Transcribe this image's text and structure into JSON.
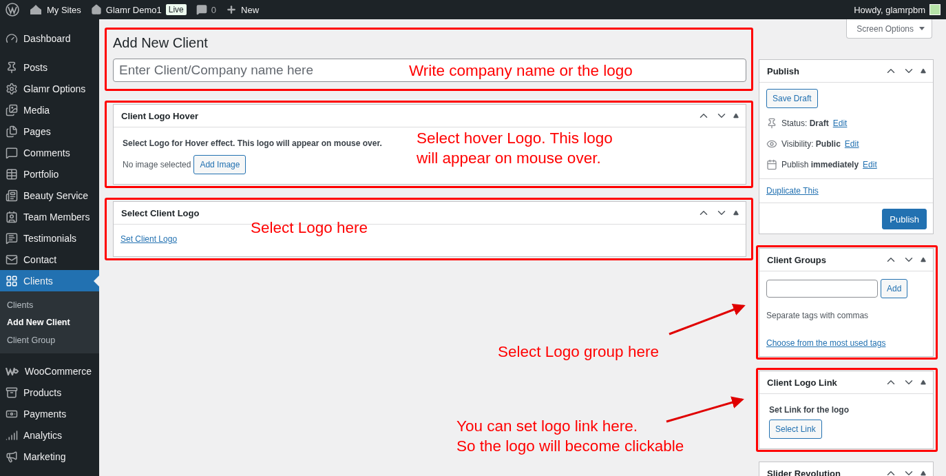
{
  "admin_bar": {
    "items": [
      {
        "label": "My Sites"
      },
      {
        "label": "Glamr Demo1",
        "badge": "Live"
      },
      {
        "label": "0"
      },
      {
        "label": "New"
      }
    ],
    "greeting": "Howdy, glamrpbm"
  },
  "sidebar": {
    "items": [
      {
        "label": "Dashboard",
        "selected": false
      },
      {
        "label": "Posts",
        "selected": false
      },
      {
        "label": "Glamr Options",
        "selected": false
      },
      {
        "label": "Media",
        "selected": false
      },
      {
        "label": "Pages",
        "selected": false
      },
      {
        "label": "Comments",
        "selected": false
      },
      {
        "label": "Portfolio",
        "selected": false
      },
      {
        "label": "Beauty Service",
        "selected": false
      },
      {
        "label": "Team Members",
        "selected": false
      },
      {
        "label": "Testimonials",
        "selected": false
      },
      {
        "label": "Contact",
        "selected": false
      },
      {
        "label": "Clients",
        "selected": true,
        "children": [
          {
            "label": "Clients",
            "selected": false
          },
          {
            "label": "Add New Client",
            "selected": true
          },
          {
            "label": "Client Group",
            "selected": false
          }
        ]
      },
      {
        "label": "WooCommerce",
        "selected": false
      },
      {
        "label": "Products",
        "selected": false
      },
      {
        "label": "Payments",
        "selected": false
      },
      {
        "label": "Analytics",
        "selected": false
      },
      {
        "label": "Marketing",
        "selected": false
      }
    ]
  },
  "screen_options": "Screen Options",
  "page_title": "Add New Client",
  "title_field": {
    "placeholder": "Enter Client/Company name here"
  },
  "postboxes": [
    {
      "title": "Client Logo Hover",
      "kind": "image",
      "text": "Select Logo for Hover effect. This logo will appear on mouse over.",
      "status": "No image selected",
      "button": "Add Image"
    },
    {
      "title": "Select Client Logo",
      "kind": "link",
      "link": "Set Client Logo"
    }
  ],
  "publish": {
    "title": "Publish",
    "save_draft": "Save Draft",
    "rows": [
      {
        "text": "Status: **Draft**",
        "link": "Edit"
      },
      {
        "text": "Visibility: **Public**",
        "link": "Edit"
      },
      {
        "text": "Publish **immediately**",
        "link": "Edit"
      }
    ],
    "duplicate": "Duplicate This",
    "button": "Publish"
  },
  "client_groups": {
    "title": "Client Groups",
    "button": "Add",
    "hint": "Separate tags with commas",
    "link": "Choose from the most used tags"
  },
  "logo_link": {
    "title": "Client Logo Link",
    "text": "Set Link for the logo",
    "button": "Select Link"
  },
  "slider_revolution": {
    "title": "Slider Revolution"
  },
  "annotations": [
    {
      "lines": [
        "Write company name or the logo"
      ]
    },
    {
      "lines": [
        "Select hover Logo. This logo",
        "will appear on mouse over."
      ]
    },
    {
      "lines": [
        "Select Logo here"
      ]
    },
    {
      "lines": [
        "Select Logo group here"
      ]
    },
    {
      "lines": [
        "You can set logo link here.",
        "So the logo will become clickable"
      ]
    }
  ]
}
